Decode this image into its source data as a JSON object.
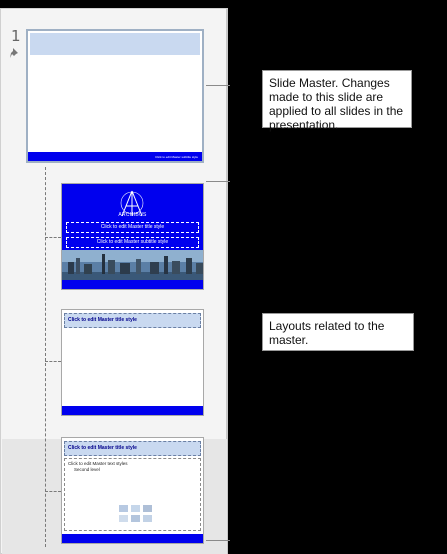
{
  "pane": {
    "slide_number": "1"
  },
  "master": {
    "footer_text": "Click to edit Master subtitle style"
  },
  "title_layout": {
    "logo_text": "ARCHIBUS",
    "title_placeholder": "Click to edit Master title style",
    "subtitle_placeholder": "Click to edit Master subtitle style"
  },
  "title_only_layout": {
    "title_placeholder": "Click to edit Master title style"
  },
  "content_layout": {
    "title_placeholder": "Click to edit Master title style",
    "bullet_1": "Click to edit Master text styles",
    "bullet_2": "Second level"
  },
  "callouts": {
    "master": "Slide Master. Changes made to this slide are applied to all slides in the presentation.",
    "layouts": "Layouts related to the master."
  },
  "colors": {
    "accent_blue": "#0000ee",
    "title_band": "#c9d9f0",
    "pane_bg": "#f4f4f4",
    "hover_bg": "#e6e6e6"
  },
  "icons": [
    "pin-icon",
    "archibus-logo",
    "content-placeholder-icons"
  ]
}
